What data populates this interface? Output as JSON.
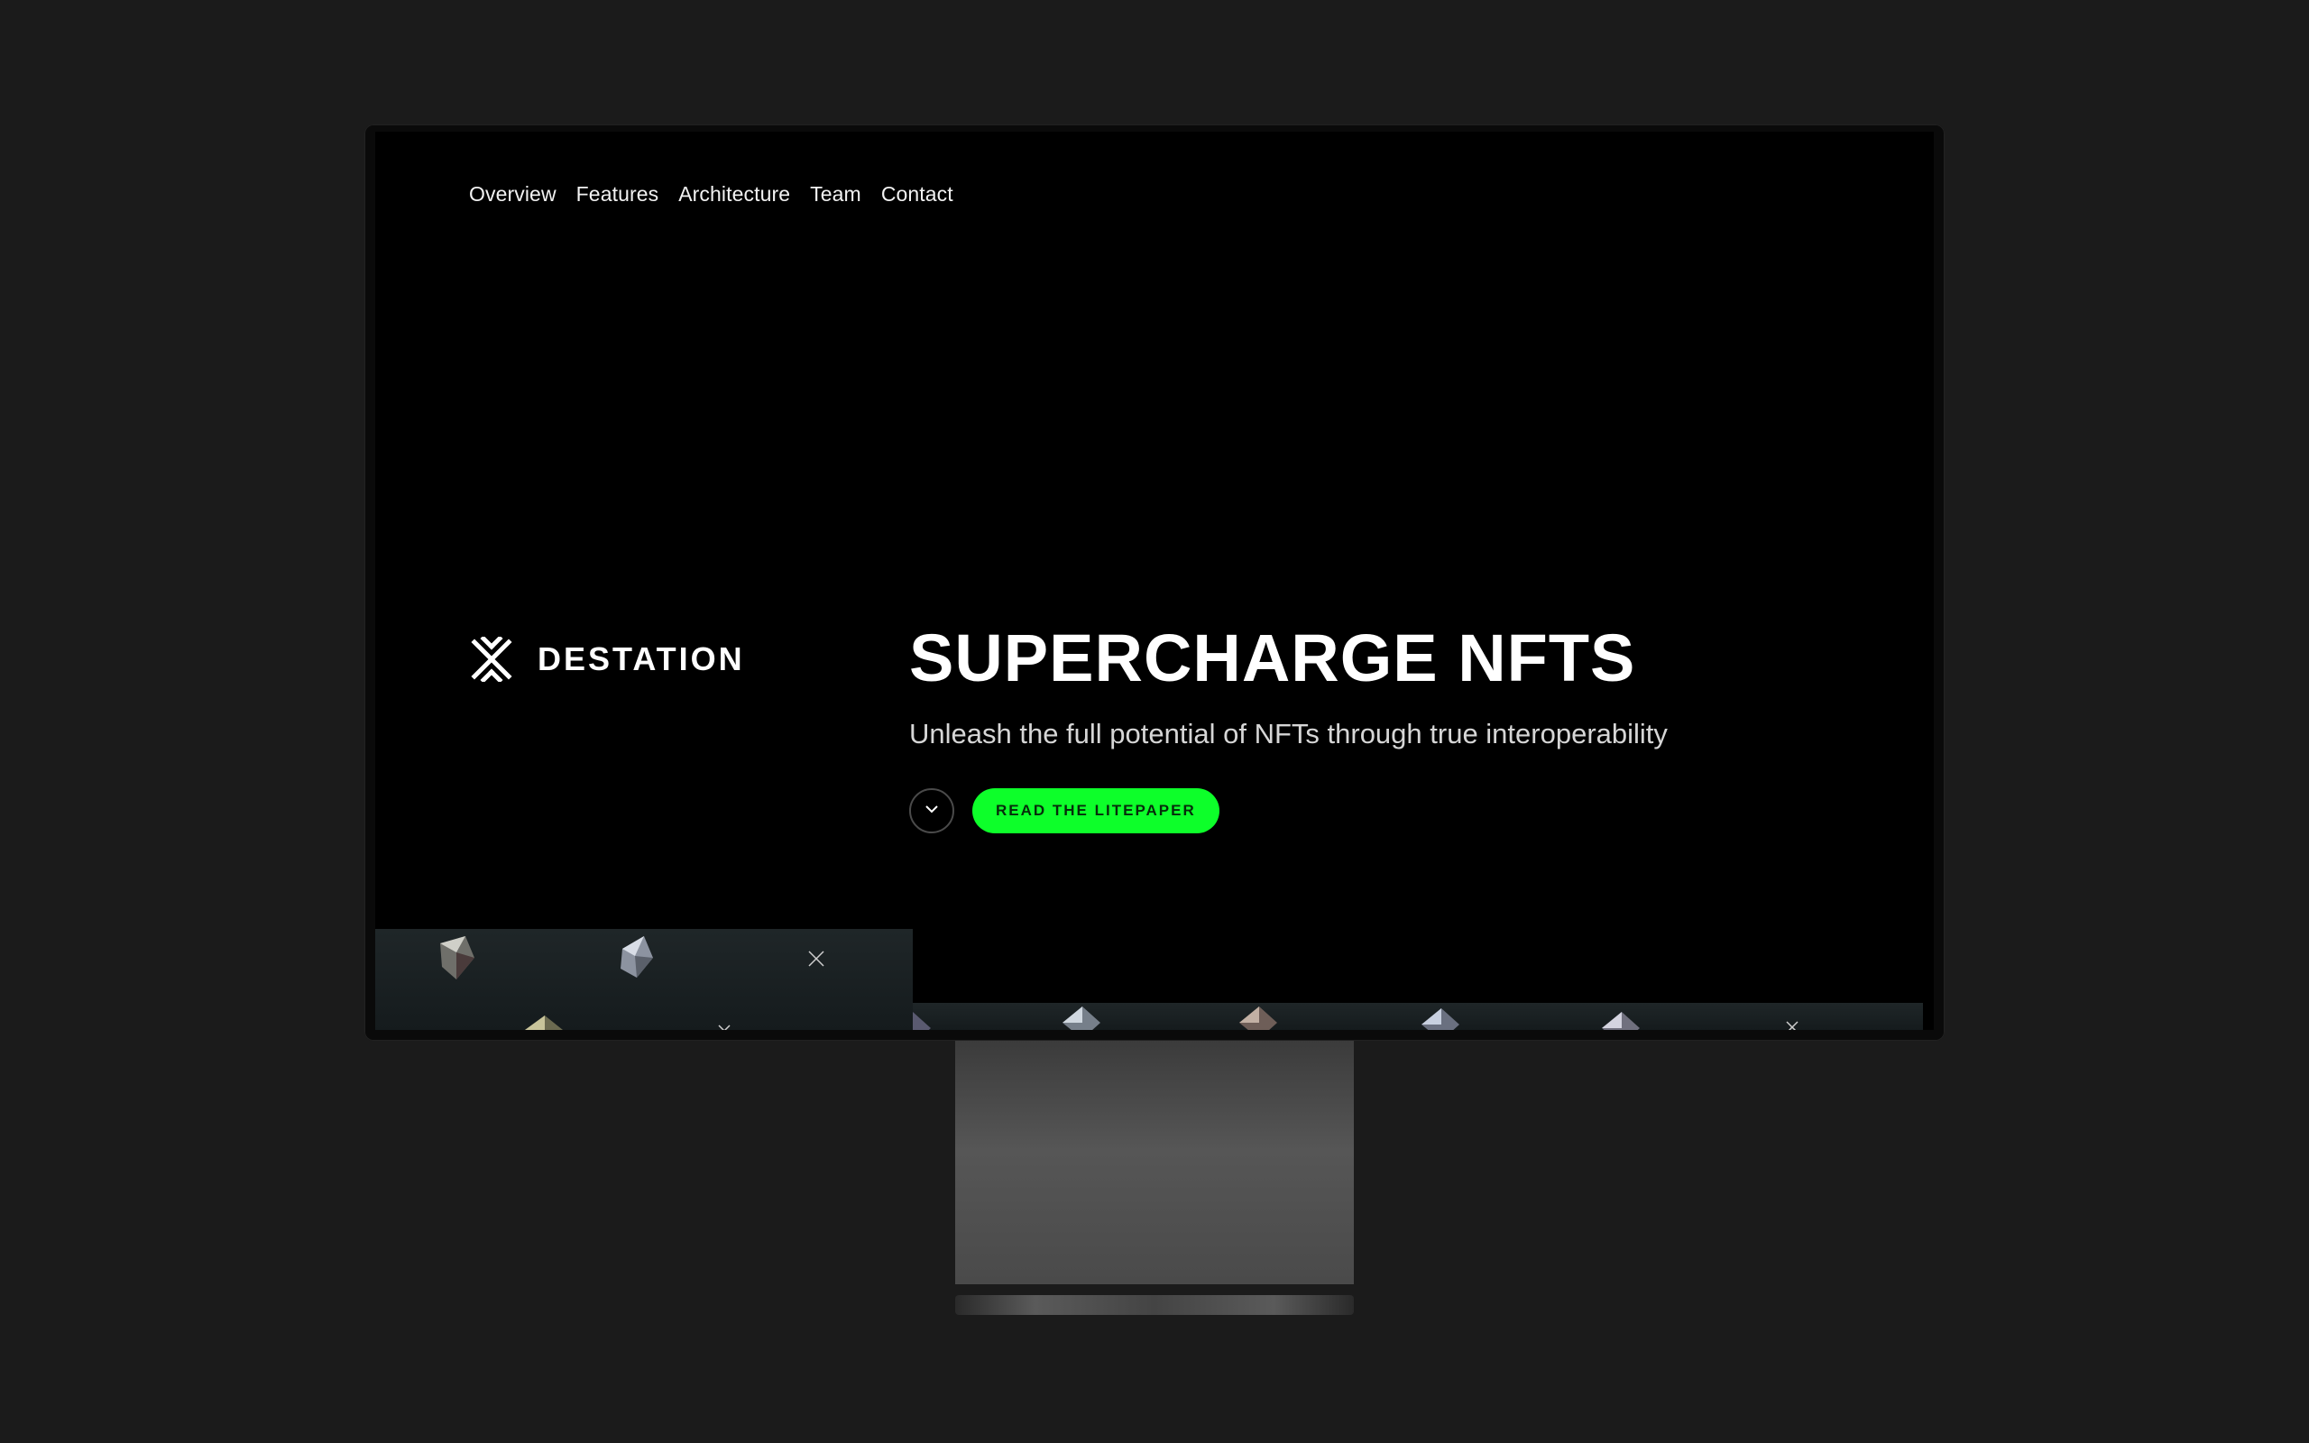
{
  "nav": {
    "items": [
      {
        "label": "Overview"
      },
      {
        "label": "Features"
      },
      {
        "label": "Architecture"
      },
      {
        "label": "Team"
      },
      {
        "label": "Contact"
      }
    ]
  },
  "brand": {
    "name": "DESTATION",
    "icon": "destation-logo-icon"
  },
  "hero": {
    "title": "SUPERCHARGE NFTS",
    "subtitle": "Unleash the full potential of NFTs through true interoperability",
    "scroll_icon": "chevron-down-icon",
    "cta_label": "READ THE LITEPAPER"
  },
  "colors": {
    "accent": "#0dff2a",
    "background": "#000000",
    "frame": "#1b1b1b"
  }
}
